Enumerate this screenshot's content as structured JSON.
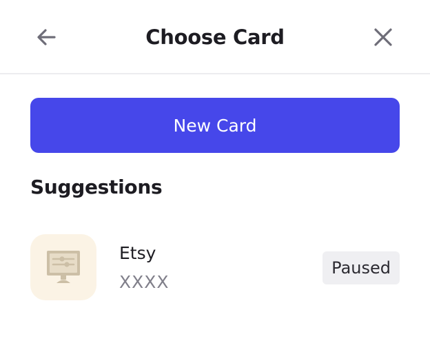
{
  "header": {
    "title": "Choose Card",
    "back_icon": "arrow-left-icon",
    "close_icon": "close-icon"
  },
  "actions": {
    "new_card_label": "New Card"
  },
  "suggestions": {
    "title": "Suggestions",
    "items": [
      {
        "merchant": "Etsy",
        "card_number": "XXXX",
        "status": "Paused",
        "icon": "merchant-terminal-icon"
      }
    ]
  },
  "colors": {
    "accent": "#4647ea",
    "merchant_icon_bg": "#fbf3e5",
    "merchant_icon_fg": "#ccbfa6",
    "badge_bg": "#efeff2",
    "muted_text": "#807f8a",
    "icon_gray": "#6e6d78"
  }
}
